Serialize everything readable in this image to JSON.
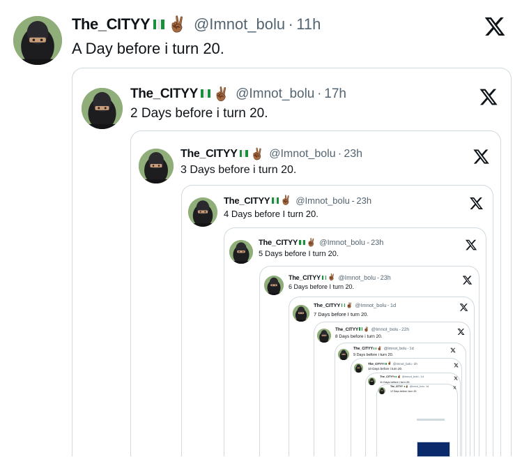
{
  "icons": {
    "x_logo": "x-logo-icon",
    "flag": "nigeria-flag-icon",
    "hand": "victory-hand-icon",
    "avatar": "masked-avatar"
  },
  "colors": {
    "text": "#0f1419",
    "muted": "#536471",
    "border": "#cfd9de",
    "flag_green": "#1a8f3c"
  },
  "posts": [
    {
      "name": "The_CITYY",
      "hand": "✌🏾",
      "handle": "@Imnot_bolu",
      "dot": "·",
      "time": "11h",
      "text": "A Day before i turn 20."
    },
    {
      "name": "The_CITYY",
      "hand": "✌🏾",
      "handle": "@Imnot_bolu",
      "dot": "·",
      "time": "17h",
      "text": "2 Days before i turn 20."
    },
    {
      "name": "The_CITYY",
      "hand": "✌🏾",
      "handle": "@Imnot_bolu",
      "dot": "·",
      "time": "23h",
      "text": "3 Days before i turn 20."
    },
    {
      "name": "The_CITYY",
      "hand": "✌🏾",
      "handle": "@Imnot_bolu",
      "dot": "-",
      "time": "23h",
      "text": "4 Days before I turn 20."
    },
    {
      "name": "The_CITYY",
      "hand": "✌🏾",
      "handle": "@Imnot_bolu",
      "dot": "-",
      "time": "23h",
      "text": "5 Days before I turn 20."
    },
    {
      "name": "The_CITYY",
      "hand": "✌🏾",
      "handle": "@Imnot_bolu",
      "dot": "-",
      "time": "23h",
      "text": "6 Days before I turn 20."
    },
    {
      "name": "The_CITYY",
      "hand": "✌🏾",
      "handle": "@Imnot_bolu",
      "dot": "-",
      "time": "1d",
      "text": "7 Days before I turn 20."
    },
    {
      "name": "The_CITYY",
      "hand": "✌🏾",
      "handle": "@Imnot_bolu",
      "dot": "-",
      "time": "22h",
      "text": "8 Days before i turn 20."
    },
    {
      "name": "The_CITYY",
      "hand": "✌🏾",
      "handle": "@Imnot_bolu",
      "dot": "-",
      "time": "1d",
      "text": "9 Days before i turn 20."
    },
    {
      "name": "The_CITYY",
      "hand": "✌🏾",
      "handle": "@Imnot_bolu",
      "dot": "-",
      "time": "2h",
      "text": "10 Days before i turn 20."
    },
    {
      "name": "The_CITYY",
      "hand": "✌🏾",
      "handle": "@Imnot_bolu",
      "dot": "-",
      "time": "1d",
      "text": "11 Days before i turn 20."
    },
    {
      "name": "The_CITYY",
      "hand": "✌🏾",
      "handle": "@Imnot_bolu",
      "dot": "-",
      "time": "1d",
      "text": "12 Days before i turn 20."
    }
  ]
}
